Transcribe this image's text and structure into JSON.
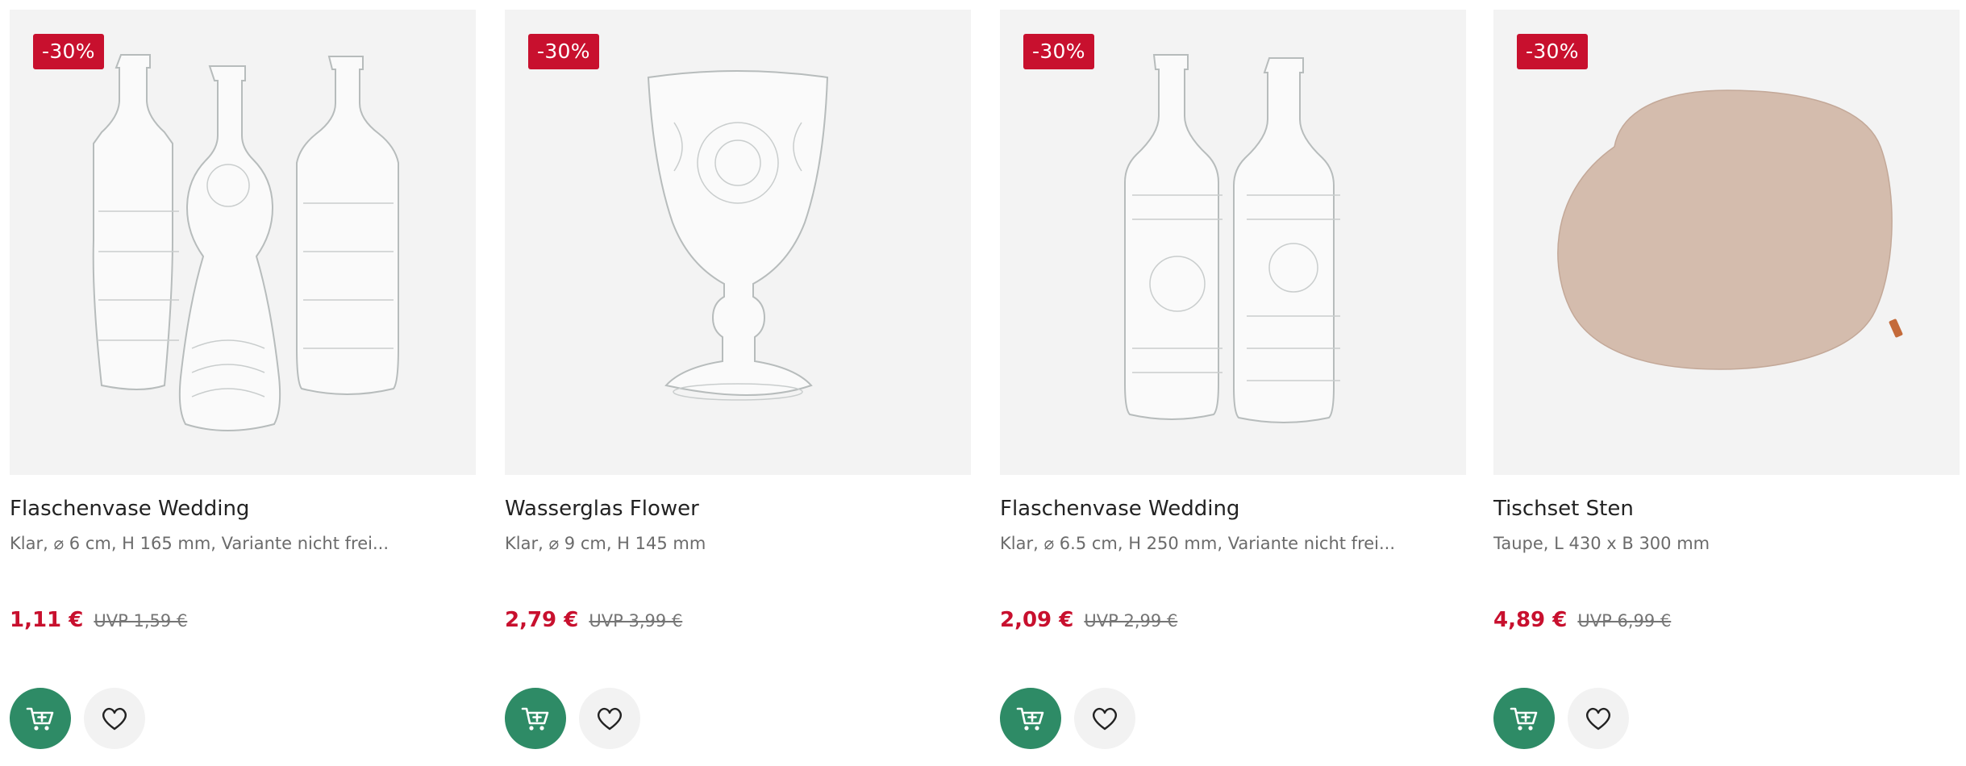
{
  "products": [
    {
      "badge": "-30%",
      "title": "Flaschenvase Wedding",
      "subtitle": "Klar, ⌀ 6 cm, H 165 mm, Variante nicht frei...",
      "price": "1,11 €",
      "uvp": "UVP 1,59 €",
      "image_icon": "three-glass-bottles",
      "actions": {
        "cart_icon": "add-to-cart-icon",
        "fav_icon": "heart-icon"
      }
    },
    {
      "badge": "-30%",
      "title": "Wasserglas Flower",
      "subtitle": "Klar, ⌀ 9 cm, H 145 mm",
      "price": "2,79 €",
      "uvp": "UVP 3,99 €",
      "image_icon": "stemmed-glass",
      "actions": {
        "cart_icon": "add-to-cart-icon",
        "fav_icon": "heart-icon"
      }
    },
    {
      "badge": "-30%",
      "title": "Flaschenvase Wedding",
      "subtitle": "Klar, ⌀ 6.5 cm, H 250 mm, Variante nicht frei...",
      "price": "2,09 €",
      "uvp": "UVP 2,99 €",
      "image_icon": "two-glass-bottles",
      "actions": {
        "cart_icon": "add-to-cart-icon",
        "fav_icon": "heart-icon"
      }
    },
    {
      "badge": "-30%",
      "title": "Tischset Sten",
      "subtitle": "Taupe, L 430 x B 300 mm",
      "price": "4,89 €",
      "uvp": "UVP 6,99 €",
      "image_icon": "oval-placemat",
      "actions": {
        "cart_icon": "add-to-cart-icon",
        "fav_icon": "heart-icon"
      }
    }
  ],
  "colors": {
    "sale_red": "#c8102e",
    "cart_green": "#2e8b66",
    "image_bg": "#f3f3f3",
    "placemat_taupe": "#d2b8a8"
  }
}
